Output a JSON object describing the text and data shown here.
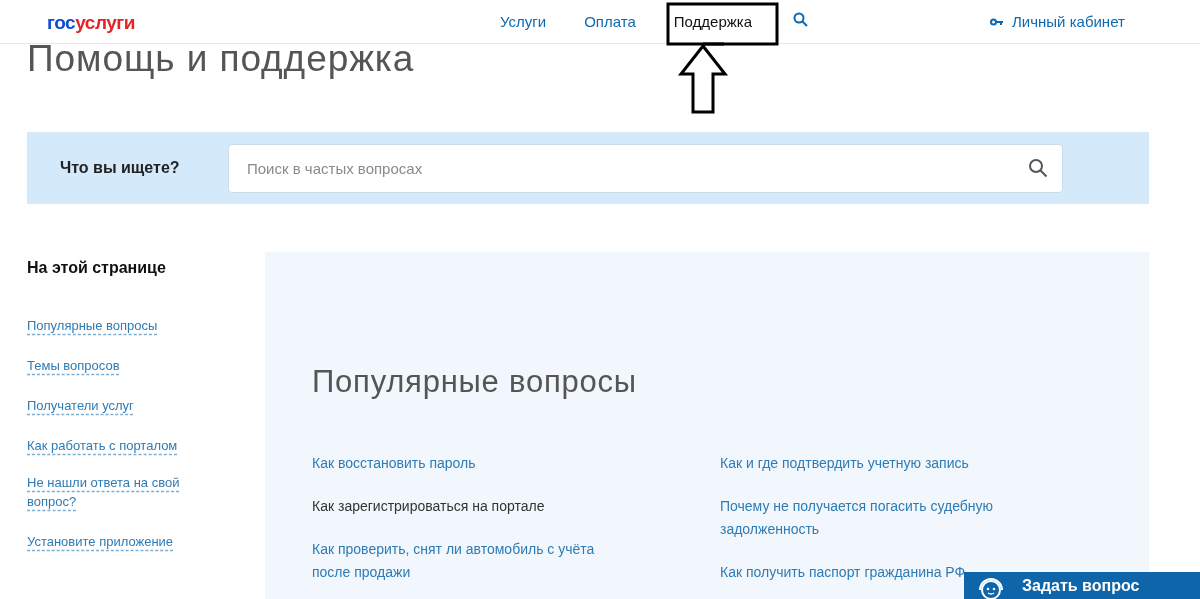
{
  "header": {
    "logo": {
      "part1": "гос",
      "part2": "услуги"
    },
    "nav": [
      {
        "label": "Услуги",
        "selected": false
      },
      {
        "label": "Оплата",
        "selected": false
      },
      {
        "label": "Поддержка",
        "selected": true
      }
    ],
    "account": "Личный кабинет"
  },
  "page_title": "Помощь и поддержка",
  "search": {
    "label": "Что вы ищете?",
    "placeholder": "Поиск в частых вопросах"
  },
  "sidebar": {
    "title": "На этой странице",
    "items": [
      "Популярные вопросы",
      "Темы вопросов",
      "Получатели услуг",
      "Как работать с порталом",
      "Не нашли ответа на свой вопрос?",
      "Установите приложение"
    ]
  },
  "popular": {
    "title": "Популярные вопросы",
    "columns": [
      [
        {
          "text": "Как восстановить пароль",
          "hovered": false
        },
        {
          "text": "Как зарегистрироваться на портале",
          "hovered": true
        },
        {
          "text": "Как проверить, снят ли автомобиль с учёта после продажи",
          "hovered": false
        }
      ],
      [
        {
          "text": "Как и где подтвердить учетную запись",
          "hovered": false
        },
        {
          "text": "Почему не получается погасить судебную задолженность",
          "hovered": false
        },
        {
          "text": "Как получить паспорт гражданина РФ",
          "hovered": false
        }
      ]
    ]
  },
  "chat_button": "Задать вопрос"
}
